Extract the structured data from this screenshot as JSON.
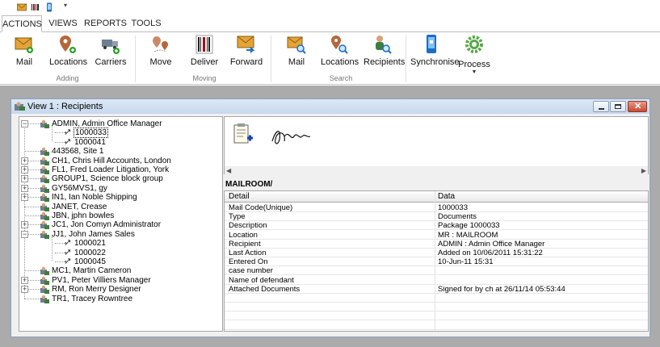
{
  "tabs": [
    {
      "label": "ACTIONS",
      "active": true
    },
    {
      "label": "VIEWS",
      "active": false
    },
    {
      "label": "REPORTS",
      "active": false
    },
    {
      "label": "TOOLS",
      "active": false
    }
  ],
  "ribbon": {
    "adding": {
      "label": "Adding",
      "buttons": [
        "Mail",
        "Locations",
        "Carriers"
      ]
    },
    "moving": {
      "label": "Moving",
      "buttons": [
        "Move",
        "Deliver",
        "Forward"
      ]
    },
    "search": {
      "label": "Search",
      "buttons": [
        "Mail",
        "Locations",
        "Recipients"
      ]
    },
    "synchronise": "Synchronise",
    "process": "Process"
  },
  "window": {
    "title": "View 1 : Recipients"
  },
  "tree": [
    "ADMIN, Admin Office Manager",
    "1000033",
    "1000041",
    "443568, Site 1",
    "CH1, Chris Hill Accounts, London",
    "FL1, Fred Loader Litigation, York",
    "GROUP1, Science block group",
    "GY56MVS1, gy",
    "IN1, Ian Noble Shipping",
    "JANET, Crease",
    "JBN, jphn bowles",
    "JC1, Jon Comyn Administrator",
    "JJ1, John James Sales",
    "1000021",
    "1000022",
    "1000045",
    "MC1, Martin Cameron",
    "PV1, Peter Villiers Manager",
    "RM, Ron Merry Designer",
    "TR1, Tracey Rowntree"
  ],
  "section_label": "MAILROOM/",
  "grid": {
    "headers": [
      "Detail",
      "Data"
    ],
    "rows": [
      [
        "Mail Code(Unique)",
        "1000033"
      ],
      [
        "Type",
        "Documents"
      ],
      [
        "Description",
        "Package 1000033"
      ],
      [
        "Location",
        "MR : MAILROOM"
      ],
      [
        "Recipient",
        "ADMIN : Admin Office Manager"
      ],
      [
        "Last Action",
        "Added on 10/06/2011 15:31:22"
      ],
      [
        "Entered On",
        "10-Jun-11 15:31"
      ],
      [
        "case number",
        ""
      ],
      [
        "Name of defendant",
        ""
      ],
      [
        "Attached Documents",
        "Signed for by ch at 26/11/14 05:53:44"
      ]
    ]
  },
  "colors": {
    "accent": "#1a6fc4",
    "envelope": "#e4a437",
    "green_plus": "#2ca02c",
    "pin": "#b5673c"
  }
}
